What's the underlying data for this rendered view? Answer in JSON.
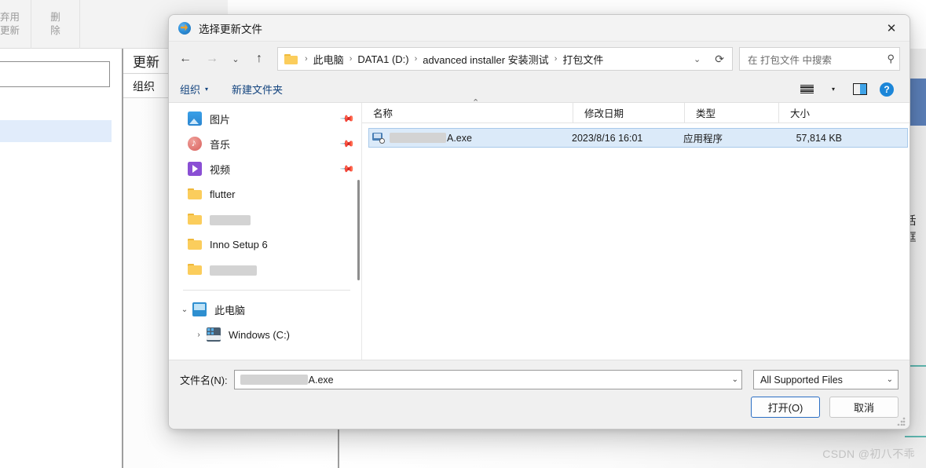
{
  "background": {
    "toolbar_buttons": [
      {
        "name": "abandon-update",
        "line1": "弃用",
        "line2": "更新"
      },
      {
        "name": "delete",
        "line1": "删",
        "line2": "除"
      }
    ],
    "panel_tabs": [
      {
        "label": "更新"
      },
      {
        "label": "组织"
      }
    ],
    "side_text": "话框"
  },
  "dialog": {
    "title": "选择更新文件",
    "close_label": "✕",
    "nav": {
      "back": "←",
      "forward": "→",
      "recent": "⌄",
      "up": "↑"
    },
    "breadcrumb": {
      "separator": "›",
      "items": [
        "此电脑",
        "DATA1 (D:)",
        "advanced installer 安装测试",
        "打包文件"
      ],
      "history_chevron": "⌄",
      "refresh": "⟳"
    },
    "search": {
      "placeholder": "在 打包文件 中搜索",
      "icon": "search-icon"
    },
    "commandbar": {
      "organize_label": "组织",
      "organize_caret": "▾",
      "new_folder_label": "新建文件夹",
      "view_caret": "▾"
    },
    "sidebar": {
      "items": [
        {
          "label": "图片",
          "icon": "pictures-icon",
          "pinned": true,
          "redacted": false
        },
        {
          "label": "音乐",
          "icon": "music-icon",
          "pinned": true,
          "redacted": false
        },
        {
          "label": "视频",
          "icon": "videos-icon",
          "pinned": true,
          "redacted": false
        },
        {
          "label": "flutter",
          "icon": "folder-icon",
          "pinned": false,
          "redacted": false
        },
        {
          "label": "",
          "icon": "folder-icon",
          "pinned": false,
          "redacted": true,
          "redact_width": 52
        },
        {
          "label": "Inno Setup 6",
          "icon": "folder-icon",
          "pinned": false,
          "redacted": false
        },
        {
          "label": "",
          "icon": "folder-icon",
          "pinned": false,
          "redacted": true,
          "redact_width": 60
        }
      ],
      "tree": [
        {
          "label": "此电脑",
          "icon": "this-pc-icon",
          "chevron": "⌄",
          "level": 1
        },
        {
          "label": "Windows (C:)",
          "icon": "drive-icon",
          "chevron": "›",
          "level": 2
        }
      ]
    },
    "filelist": {
      "columns": [
        {
          "key": "name",
          "label": "名称"
        },
        {
          "key": "date",
          "label": "修改日期"
        },
        {
          "key": "type",
          "label": "类型"
        },
        {
          "key": "size",
          "label": "大小"
        }
      ],
      "sort_indicator": "⌃",
      "rows": [
        {
          "name_suffix": "A.exe",
          "name_redacted": true,
          "date": "2023/8/16 16:01",
          "type": "应用程序",
          "size": "57,814 KB",
          "selected": true
        }
      ]
    },
    "footer": {
      "filename_label": "文件名(N):",
      "filename_value_suffix": "A.exe",
      "filename_redacted": true,
      "filename_chevron": "⌄",
      "filetype_value": "All Supported Files",
      "filetype_chevron": "⌄",
      "open_button": "打开(O)",
      "cancel_button": "取消"
    }
  },
  "watermark": "CSDN @初八不乖",
  "colors": {
    "accent_blue": "#1c86d8",
    "selection_bg": "#dbeaf9",
    "selection_border": "#a8c9ea",
    "link_blue": "#12437e",
    "folder_yellow": "#fbcd5c"
  }
}
